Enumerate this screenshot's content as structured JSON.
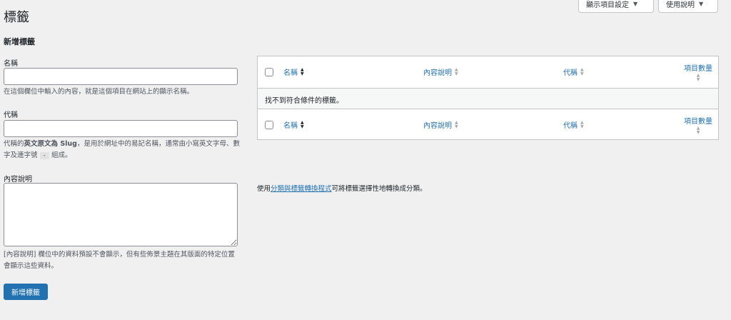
{
  "header": {
    "title": "標籤",
    "screen_options_label": "顯示項目設定",
    "help_label": "使用說明"
  },
  "form": {
    "heading": "新增標籤",
    "name_label": "名稱",
    "name_desc": "在這個欄位中輸入的內容，就是這個項目在網站上的顯示名稱。",
    "slug_label": "代稱",
    "slug_desc_prefix": "代稱的",
    "slug_desc_bold": "英文原文為 Slug",
    "slug_desc_mid": "，是用於網址中的易記名稱，通常由小寫英文字母、數字及連字號",
    "slug_desc_code": "-",
    "slug_desc_suffix": "組成。",
    "description_label": "內容說明",
    "description_desc": "[內容說明] 欄位中的資料預設不會顯示，但有些佈景主題在其版面的特定位置會顯示這些資料。",
    "submit_label": "新增標籤"
  },
  "table": {
    "columns": [
      "名稱",
      "內容說明",
      "代稱",
      "項目數量"
    ],
    "empty_message": "找不到符合條件的標籤。"
  },
  "note": {
    "prefix": "使用",
    "link": "分類與標籤轉換程式",
    "suffix": "可將標籤選擇性地轉換成分類。"
  }
}
